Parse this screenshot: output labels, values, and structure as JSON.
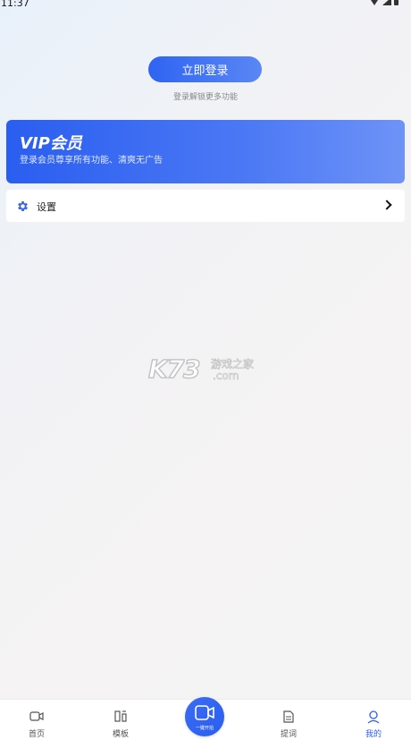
{
  "status": {
    "time": "11:37"
  },
  "login": {
    "button_label": "立即登录",
    "hint": "登录解锁更多功能"
  },
  "vip": {
    "title": "VIP会员",
    "subtitle": "登录会员尊享所有功能、清爽无广告"
  },
  "settings": {
    "label": "设置",
    "icon": "gear-icon"
  },
  "watermark": {
    "brand": "K73",
    "cn": "游戏之家",
    "domain": ".com"
  },
  "tabs": [
    {
      "label": "首页",
      "icon": "video-camera-icon"
    },
    {
      "label": "模板",
      "icon": "template-icon"
    },
    {
      "label": "一键开拍",
      "icon": "record-icon"
    },
    {
      "label": "提词",
      "icon": "document-icon"
    },
    {
      "label": "我的",
      "icon": "user-icon"
    }
  ],
  "colors": {
    "accent": "#2a5ef0",
    "active_tab": "#2a5ef0"
  }
}
